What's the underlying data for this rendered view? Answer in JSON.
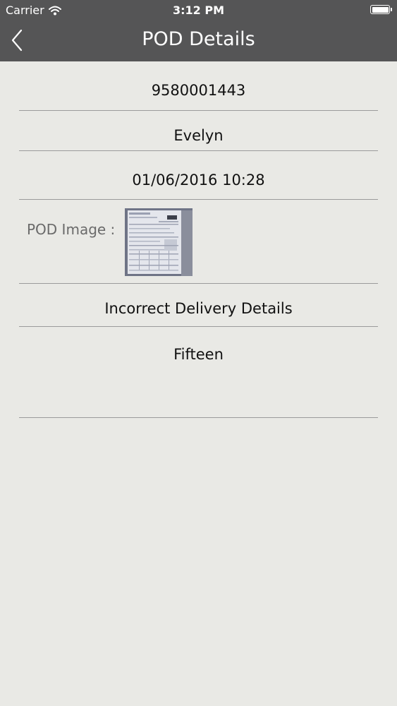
{
  "status_bar": {
    "carrier": "Carrier",
    "time": "3:12 PM",
    "battery_level": 1.0
  },
  "nav": {
    "title": "POD Details"
  },
  "details": {
    "reference": "9580001443",
    "name": "Evelyn",
    "datetime": "01/06/2016 10:28",
    "pod_image_label": "POD Image :",
    "reason": "Incorrect Delivery Details",
    "notes": "Fifteen"
  },
  "colors": {
    "bar_background": "#555556",
    "page_background": "#e9e9e5",
    "divider": "#9b9b9b"
  }
}
